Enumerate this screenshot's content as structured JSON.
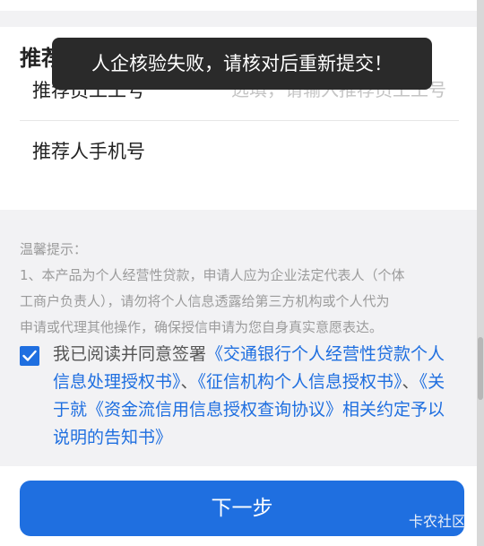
{
  "form": {
    "section_title": "推荐",
    "referrer_id": {
      "label": "推荐员工工号",
      "value": "",
      "placeholder": "选填，请输入推荐员工工号"
    },
    "referrer_phone": {
      "label": "推荐人手机号",
      "value": "",
      "placeholder": ""
    }
  },
  "toast": {
    "message": "人企核验失败，请核对后重新提交！"
  },
  "tips": {
    "title": "温馨提示：",
    "lines": [
      "1、本产品为个人经营性贷款，申请人应为企业法定代表人（个体",
      "工商户负责人），请勿将个人信息透露给第三方机构或个人代为",
      "申请或代理其他操作，确保授信申请为您自身真实意愿表达。"
    ]
  },
  "agreement": {
    "checked": true,
    "prefix": "我已阅读并同意签署",
    "doc1": "《交通银行个人经营性贷款个人信息处理授权书》",
    "sep1": "、",
    "doc2": "《征信机构个人信息授权书》",
    "sep2": "、",
    "doc3": "《关于就《资金流信用信息授权查询协议》相关约定予以说明的告知书》"
  },
  "actions": {
    "next_label": "下一步"
  },
  "watermark": "卡农社区",
  "colors": {
    "brand_blue": "#1f6fe0",
    "toast_bg": "#2a2a2a",
    "page_bg": "#f2f2f4"
  }
}
